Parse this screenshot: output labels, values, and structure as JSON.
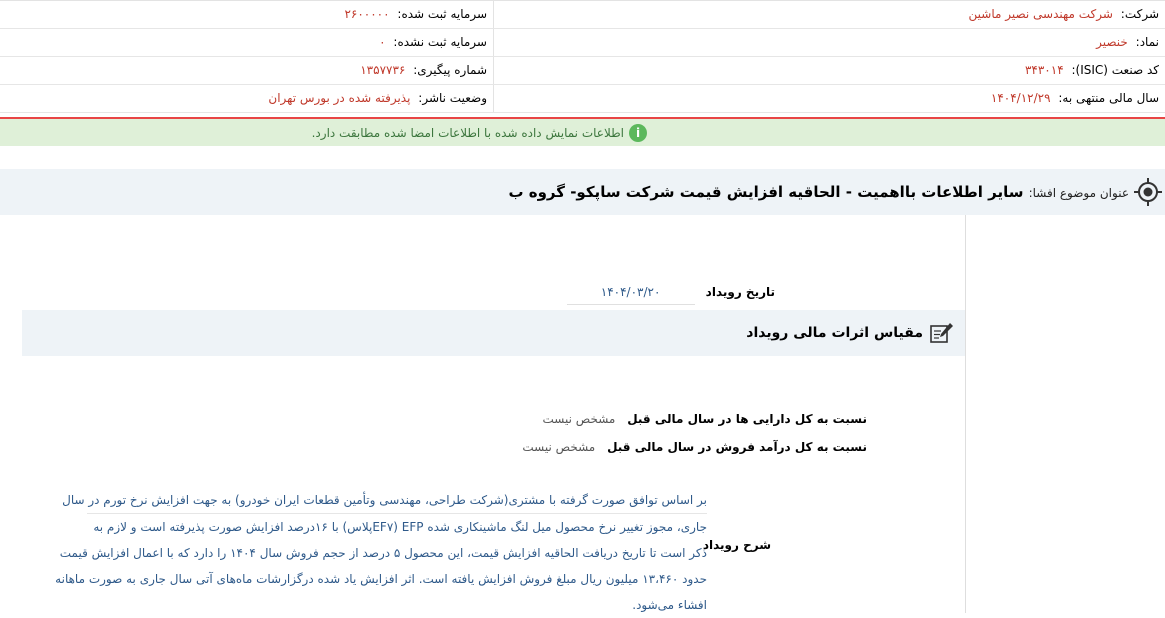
{
  "company_info": {
    "rows": [
      {
        "right_label": "شرکت:",
        "right_value": "شرکت مهندسی نصیر ماشین",
        "left_label": "سرمایه ثبت شده:",
        "left_value": "۲۶۰۰۰۰۰"
      },
      {
        "right_label": "نماد:",
        "right_value": "خنصیر",
        "left_label": "سرمایه ثبت نشده:",
        "left_value": "۰"
      },
      {
        "right_label": "کد صنعت (ISIC):",
        "right_value": "۳۴۳۰۱۴",
        "left_label": "شماره پیگیری:",
        "left_value": "۱۳۵۷۷۳۶"
      },
      {
        "right_label": "سال مالی منتهی به:",
        "right_value": "۱۴۰۴/۱۲/۲۹",
        "left_label": "وضعیت ناشر:",
        "left_value": "پذیرفته شده در بورس تهران"
      }
    ]
  },
  "alert": {
    "icon": "info-icon",
    "text": "اطلاعات نمایش داده شده با اطلاعات امضا شده مطابقت دارد.",
    "color": "#3c763d"
  },
  "subject": {
    "label": "عنوان موضوع افشا:",
    "value": "سایر اطلاعات بااهمیت - الحاقیه افزایش قیمت شرکت ساپکو- گروه ب"
  },
  "event": {
    "date_label": "تاریخ رویداد",
    "date_value": "۱۴۰۴/۰۳/۲۰"
  },
  "financial_section": {
    "title": "مقیاس اثرات مالی رویداد",
    "ratios": [
      {
        "label": "نسبت به کل دارایی ها در سال مالی قبل",
        "value": "مشخص نیست"
      },
      {
        "label": "نسبت به کل درآمد فروش در سال مالی قبل",
        "value": "مشخص نیست"
      }
    ]
  },
  "description": {
    "label": "شرح رویداد",
    "lines": [
      "بر اساس توافق صورت گرفته با مشتری(شرکت طراحی، مهندسی وتأمین قطعات ایران خودرو) به جهت افزایش نرخ تورم در سال",
      "جاری، مجوز تغییر نرخ محصول میل لنگ ماشینکاری شده EFP (EF۷پلاس) با ۱۶درصد افزایش صورت پذیرفته است و لازم به",
      "ذکر است تا تاریخ دریافت الحاقیه افزایش قیمت، این محصول ۵ درصد از حجم فروش سال ۱۴۰۴ را دارد که با اعمال افزایش قیمت",
      "حدود ۱۳،۴۶۰ میلیون ریال مبلغ فروش افزایش یافته است. اثر افزایش یاد شده درگزارشات ماه‌های آتی سال جاری به صورت ماهانه",
      "افشاء می‌شود."
    ]
  },
  "colors": {
    "value_red": "#c0392b",
    "link_blue": "#2f5a8a",
    "alert_bg": "#dff0d8",
    "alert_border": "#e84545",
    "section_bg": "#eef3f7"
  }
}
